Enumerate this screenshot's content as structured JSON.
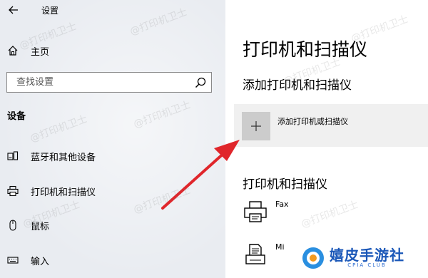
{
  "app": {
    "title": "设置"
  },
  "sidebar": {
    "home_label": "主页",
    "section_title": "设备",
    "items": [
      {
        "label": "蓝牙和其他设备",
        "icon": "bluetooth-devices-icon"
      },
      {
        "label": "打印机和扫描仪",
        "icon": "printer-icon"
      },
      {
        "label": "鼠标",
        "icon": "mouse-icon"
      },
      {
        "label": "输入",
        "icon": "keyboard-icon"
      }
    ]
  },
  "search": {
    "placeholder": "查找设置",
    "icon": "search-icon"
  },
  "main": {
    "title": "打印机和扫描仪",
    "add_section_title": "添加打印机和扫描仪",
    "add_button_label": "添加打印机或扫描仪",
    "devices_section_title": "打印机和扫描仪",
    "devices": [
      {
        "name": "Fax",
        "icon": "fax-printer-icon"
      },
      {
        "name": "Mi",
        "icon": "document-printer-icon"
      }
    ]
  },
  "watermark_text": "@打印机卫士",
  "logo": {
    "text": "嬉皮手游社",
    "sub": "CPIA CLUB"
  },
  "colors": {
    "sidebar_bg": "#e9ecf1",
    "add_tile_bg": "#cccccc",
    "arrow": "#e0262b",
    "logo": "#1a57b8"
  }
}
